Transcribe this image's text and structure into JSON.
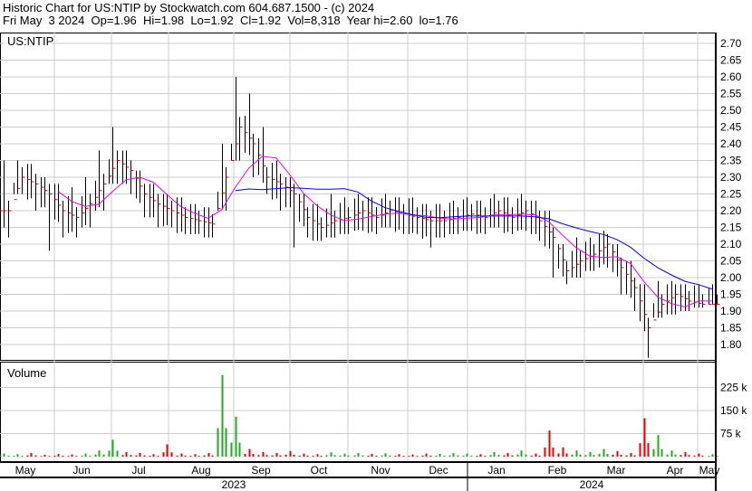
{
  "header": {
    "line1": "Historic Chart for US:NTIP by Stockwatch.com 604.687.1500 - (c) 2024",
    "line2": "Fri May  3 2024  Op=1.96  Hi=1.98  Lo=1.92  Cl=1.92  Vol=8,318  Year hi=2.60  lo=1.76"
  },
  "chart_data": {
    "type": "line",
    "symbol": "US:NTIP",
    "volume_label": "Volume",
    "ylim": [
      1.75,
      2.72
    ],
    "price_ticks": [
      "2.70",
      "2.65",
      "2.60",
      "2.55",
      "2.50",
      "2.45",
      "2.40",
      "2.35",
      "2.30",
      "2.25",
      "2.20",
      "2.15",
      "2.10",
      "2.05",
      "2.00",
      "1.95",
      "1.90",
      "1.85",
      "1.80"
    ],
    "volume_ticks": [
      "225 k",
      "150 k",
      "75 k"
    ],
    "months": [
      "May",
      "Jun",
      "Jul",
      "Aug",
      "Sep",
      "Oct",
      "Nov",
      "Dec",
      "Jan",
      "Feb",
      "Mar",
      "Apr",
      "May"
    ],
    "years": [
      "2023",
      "2024"
    ],
    "weekly_close": [
      2.2,
      2.3,
      2.28,
      2.25,
      2.2,
      2.18,
      2.22,
      2.28,
      2.35,
      2.32,
      2.25,
      2.22,
      2.2,
      2.18,
      2.17,
      2.16,
      2.3,
      2.45,
      2.4,
      2.3,
      2.28,
      2.25,
      2.18,
      2.15,
      2.17,
      2.18,
      2.2,
      2.18,
      2.2,
      2.19,
      2.18,
      2.17,
      2.17,
      2.18,
      2.19,
      2.18,
      2.2,
      2.18,
      2.2,
      2.17,
      2.12,
      2.02,
      2.05,
      2.07,
      2.1,
      2.03,
      1.97,
      1.85,
      1.92,
      1.95,
      1.93,
      1.92,
      1.92
    ],
    "weekly_high": [
      2.35,
      2.35,
      2.34,
      2.3,
      2.28,
      2.27,
      2.3,
      2.38,
      2.45,
      2.38,
      2.32,
      2.28,
      2.25,
      2.24,
      2.22,
      2.21,
      2.4,
      2.6,
      2.55,
      2.45,
      2.35,
      2.3,
      2.25,
      2.22,
      2.25,
      2.24,
      2.25,
      2.24,
      2.25,
      2.24,
      2.24,
      2.22,
      2.22,
      2.23,
      2.24,
      2.23,
      2.25,
      2.24,
      2.25,
      2.23,
      2.2,
      2.1,
      2.12,
      2.12,
      2.14,
      2.1,
      2.05,
      1.98,
      1.99,
      1.99,
      1.98,
      1.98,
      1.98
    ],
    "weekly_low": [
      2.12,
      2.25,
      2.2,
      2.08,
      2.12,
      2.12,
      2.15,
      2.2,
      2.28,
      2.25,
      2.18,
      2.15,
      2.15,
      2.13,
      2.13,
      2.12,
      2.2,
      2.35,
      2.3,
      2.25,
      2.2,
      2.09,
      2.12,
      2.11,
      2.12,
      2.13,
      2.14,
      2.13,
      2.15,
      2.13,
      2.13,
      2.09,
      2.12,
      2.13,
      2.14,
      2.13,
      2.15,
      2.13,
      2.14,
      2.11,
      2.0,
      1.98,
      2.0,
      2.02,
      2.03,
      1.95,
      1.9,
      1.76,
      1.88,
      1.89,
      1.9,
      1.91,
      1.92
    ],
    "weekly_volume_k": [
      10,
      8,
      12,
      6,
      9,
      7,
      10,
      20,
      55,
      15,
      12,
      8,
      40,
      10,
      8,
      12,
      265,
      130,
      25,
      15,
      12,
      18,
      10,
      8,
      14,
      10,
      12,
      9,
      11,
      8,
      7,
      10,
      9,
      12,
      10,
      8,
      15,
      12,
      20,
      10,
      85,
      30,
      20,
      15,
      25,
      18,
      12,
      125,
      70,
      20,
      15,
      10,
      8
    ]
  }
}
